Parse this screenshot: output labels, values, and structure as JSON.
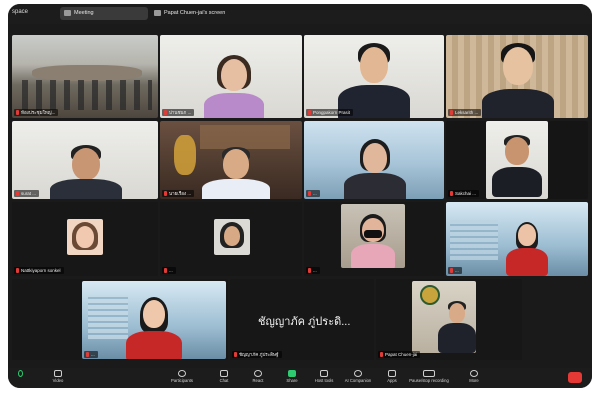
{
  "window": {
    "app_label": "space",
    "tabs": [
      {
        "label": "Meeting"
      },
      {
        "label": "Papat Chuen-jai's screen"
      }
    ]
  },
  "tiles": [
    {
      "name": "ห้องประชุมใหญ่..."
    },
    {
      "name": "ปานชนก ..."
    },
    {
      "name": "Pongpakorn Prasit"
    },
    {
      "name": "Leksarith ..."
    },
    {
      "name": "surat ..."
    },
    {
      "name": "นายเรือง ..."
    },
    {
      "name": "..."
    },
    {
      "name": "Sakchai ..."
    },
    {
      "name": "Nattkiyaporn sonkel"
    },
    {
      "name": "..."
    },
    {
      "name": "..."
    },
    {
      "name": "..."
    },
    {
      "name": "..."
    },
    {
      "name": "ชัญญาภัค ภู่ประดิษฐ์"
    },
    {
      "name": "Papat Chuen-jai"
    }
  ],
  "active_speaker_text": "ชัญญาภัค ภู่ประดิ...",
  "toolbar": {
    "items": [
      {
        "label": "Video"
      },
      {
        "label": "Participants"
      },
      {
        "label": "Chat"
      },
      {
        "label": "React"
      },
      {
        "label": "Share"
      },
      {
        "label": "Host tools"
      },
      {
        "label": "AI Companion"
      },
      {
        "label": "Apps"
      },
      {
        "label": "Pause/stop recording"
      },
      {
        "label": "More"
      }
    ]
  },
  "colors": {
    "mute": "#e53935",
    "share": "#2ecc71",
    "bar": "#1c1c1c"
  }
}
